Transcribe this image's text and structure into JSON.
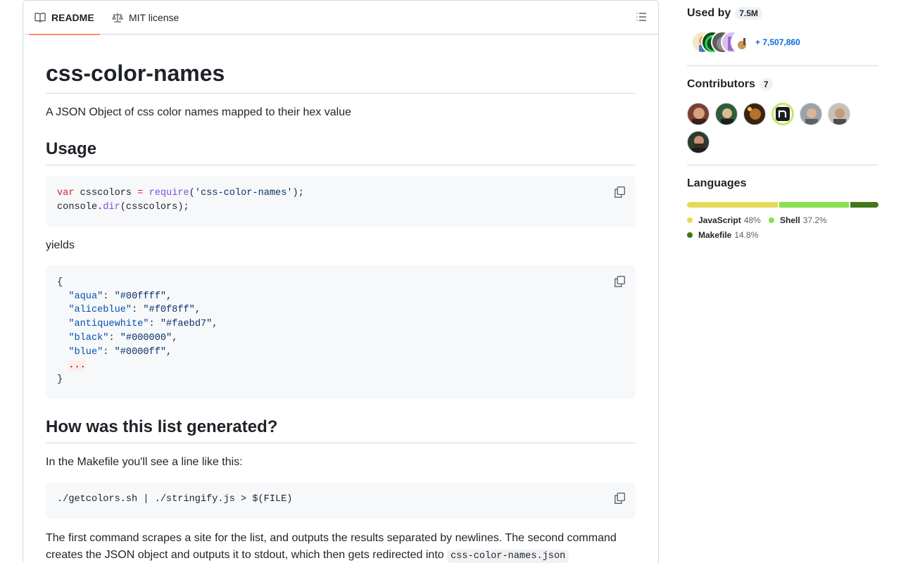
{
  "readme": {
    "tabs": [
      {
        "label": "README",
        "icon": "book-icon"
      },
      {
        "label": "MIT license",
        "icon": "law-icon"
      }
    ],
    "title": "css-color-names",
    "description": "A JSON Object of css color names mapped to their hex value",
    "usage_heading": "Usage",
    "usage_code": {
      "line1": {
        "kw": "var",
        "var": " csscolors ",
        "eq": "=",
        "fn": "require",
        "arg_open": "(",
        "arg": "'css-color-names'",
        "arg_close": ");"
      },
      "line2": {
        "obj": "console.",
        "fn": "dir",
        "rest": "(csscolors);"
      }
    },
    "yields": "yields",
    "json_code": {
      "open": "{",
      "entries": [
        {
          "key": "\"aqua\"",
          "value": "\"#00ffff\""
        },
        {
          "key": "\"aliceblue\"",
          "value": "\"#f0f8ff\""
        },
        {
          "key": "\"antiquewhite\"",
          "value": "\"#faebd7\""
        },
        {
          "key": "\"black\"",
          "value": "\"#000000\""
        },
        {
          "key": "\"blue\"",
          "value": "\"#0000ff\""
        }
      ],
      "ellipsis": "...",
      "close": "}"
    },
    "generated_heading": "How was this list generated?",
    "makefile_text": "In the Makefile you'll see a line like this:",
    "makefile_code": "./getcolors.sh | ./stringify.js > $(FILE)",
    "explanation_line1": "The first command scrapes a site for the list, and outputs the results separated by newlines. The second command",
    "explanation_line2": "creates the JSON object and outputs it to stdout, which then gets redirected into",
    "explanation_code": "css-color-names.json"
  },
  "sidebar": {
    "used_by": {
      "label": "Used by",
      "count": "7.5M",
      "more": "+ 7,507,860"
    },
    "contributors": {
      "label": "Contributors",
      "count": "7"
    },
    "languages": {
      "label": "Languages",
      "items": [
        {
          "name": "JavaScript",
          "pct": "48%",
          "value": 48,
          "color": "#e6d95a"
        },
        {
          "name": "Shell",
          "pct": "37.2%",
          "value": 37.2,
          "color": "#89e051"
        },
        {
          "name": "Makefile",
          "pct": "14.8%",
          "value": 14.8,
          "color": "#427819"
        }
      ]
    }
  },
  "colors": {
    "accent_tab": "#fd8c73",
    "link": "#0969da",
    "border": "#d1d9e0",
    "code_bg": "#f6f8fa"
  }
}
